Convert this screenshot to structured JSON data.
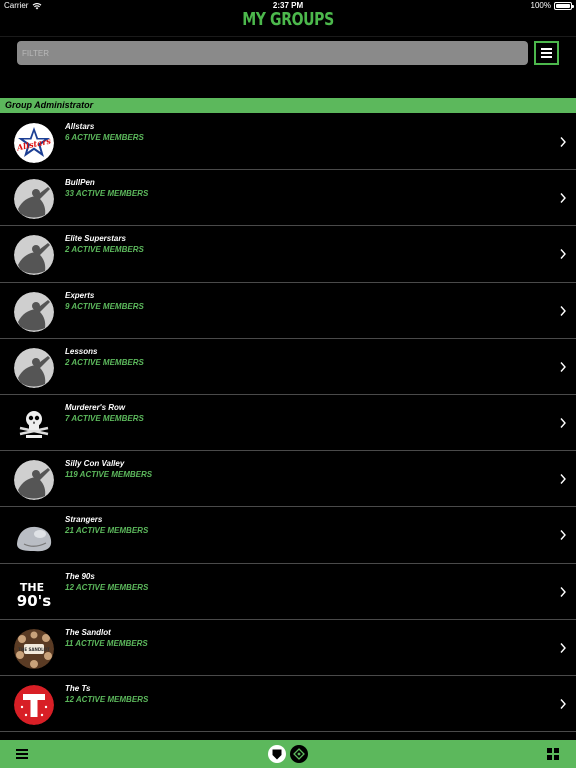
{
  "status_bar": {
    "carrier": "Carrier",
    "time": "2:37 PM",
    "battery": "100%",
    "battery_level": 1.0
  },
  "header": {
    "title": "MY GROUPS"
  },
  "filter": {
    "placeholder": "FILTER",
    "value": ""
  },
  "section": {
    "title": "Group Administrator"
  },
  "groups": [
    {
      "name": "Allstars",
      "members": "6 ACTIVE MEMBERS",
      "avatar": "allstars-logo-icon"
    },
    {
      "name": "BullPen",
      "members": "33 ACTIVE MEMBERS",
      "avatar": "batter-silhouette-icon"
    },
    {
      "name": "Elite Superstars",
      "members": "2 ACTIVE MEMBERS",
      "avatar": "batter-silhouette-icon"
    },
    {
      "name": "Experts",
      "members": "9 ACTIVE MEMBERS",
      "avatar": "batter-silhouette-icon"
    },
    {
      "name": "Lessons",
      "members": "2 ACTIVE MEMBERS",
      "avatar": "batter-silhouette-icon"
    },
    {
      "name": "Murderer's Row",
      "members": "7 ACTIVE MEMBERS",
      "avatar": "skull-crossbones-icon"
    },
    {
      "name": "Silly Con Valley",
      "members": "119 ACTIVE MEMBERS",
      "avatar": "batter-silhouette-icon"
    },
    {
      "name": "Strangers",
      "members": "21 ACTIVE MEMBERS",
      "avatar": "blob-creature-icon"
    },
    {
      "name": "The 90s",
      "members": "12 ACTIVE MEMBERS",
      "avatar": "the-90s-logo-icon"
    },
    {
      "name": "The Sandlot",
      "members": "11 ACTIVE MEMBERS",
      "avatar": "sandlot-logo-icon"
    },
    {
      "name": "The Ts",
      "members": "12 ACTIVE MEMBERS",
      "avatar": "letter-t-logo-icon"
    }
  ],
  "logo_text": {
    "allstars": "Allstars",
    "the90s_top": "THE",
    "the90s_bottom": "90's",
    "sandlot": "THE SANDLOT"
  },
  "colors": {
    "accent": "#5cb85c",
    "title_green": "#4cb84c",
    "background": "#000000"
  }
}
